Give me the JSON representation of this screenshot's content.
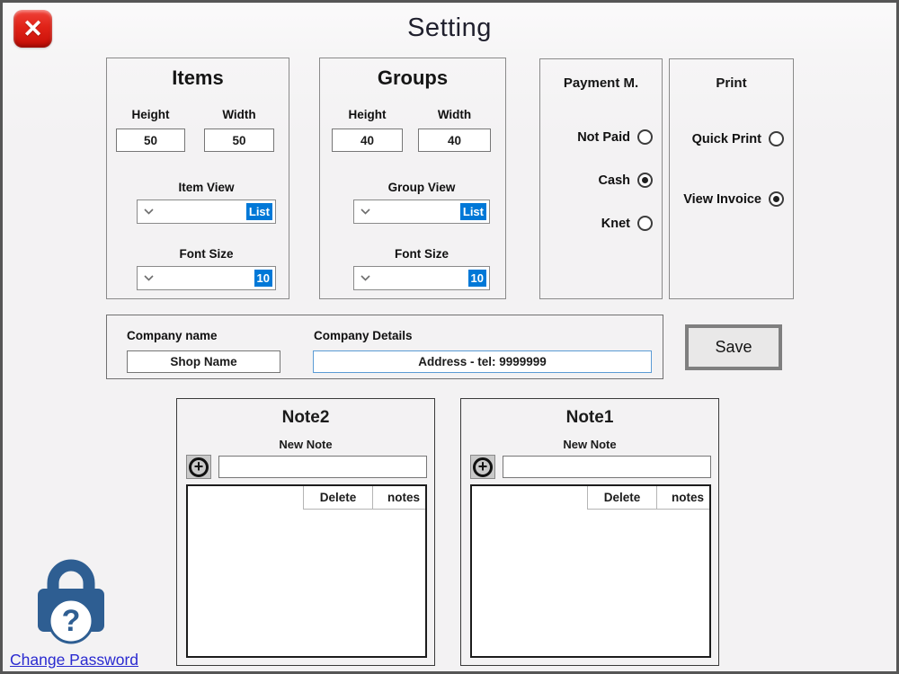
{
  "window": {
    "title": "Setting"
  },
  "close_button": {
    "glyph": "✕"
  },
  "items_panel": {
    "title": "Items",
    "height_label": "Height",
    "width_label": "Width",
    "height_value": "50",
    "width_value": "50",
    "view_label": "Item View",
    "view_value": "List",
    "font_size_label": "Font Size",
    "font_size_value": "10"
  },
  "groups_panel": {
    "title": "Groups",
    "height_label": "Height",
    "width_label": "Width",
    "height_value": "40",
    "width_value": "40",
    "view_label": "Group View",
    "view_value": "List",
    "font_size_label": "Font Size",
    "font_size_value": "10"
  },
  "payment_panel": {
    "title": "Payment M.",
    "options": [
      {
        "label": "Not Paid",
        "selected": false
      },
      {
        "label": "Cash",
        "selected": true
      },
      {
        "label": "Knet",
        "selected": false
      }
    ]
  },
  "print_panel": {
    "title": "Print",
    "options": [
      {
        "label": "Quick Print",
        "selected": false
      },
      {
        "label": "View Invoice",
        "selected": true
      }
    ]
  },
  "company_panel": {
    "name_label": "Company name",
    "name_value": "Shop Name",
    "details_label": "Company Details",
    "details_value": "Address - tel: 9999999"
  },
  "save_button": {
    "label": "Save"
  },
  "note2_panel": {
    "title": "Note2",
    "new_note_label": "New Note",
    "input_value": "",
    "table": {
      "columns": [
        "Delete",
        "notes"
      ],
      "rows": []
    }
  },
  "note1_panel": {
    "title": "Note1",
    "new_note_label": "New Note",
    "input_value": "",
    "table": {
      "columns": [
        "Delete",
        "notes"
      ],
      "rows": []
    }
  },
  "password": {
    "link_label": "Change Password",
    "question_glyph": "?"
  },
  "colors": {
    "accent_blue": "#0078d7",
    "focus_border": "#5b9bd5",
    "link_blue": "#2a2ad0",
    "lock_blue": "#2e5e92",
    "close_red": "#d91910"
  }
}
